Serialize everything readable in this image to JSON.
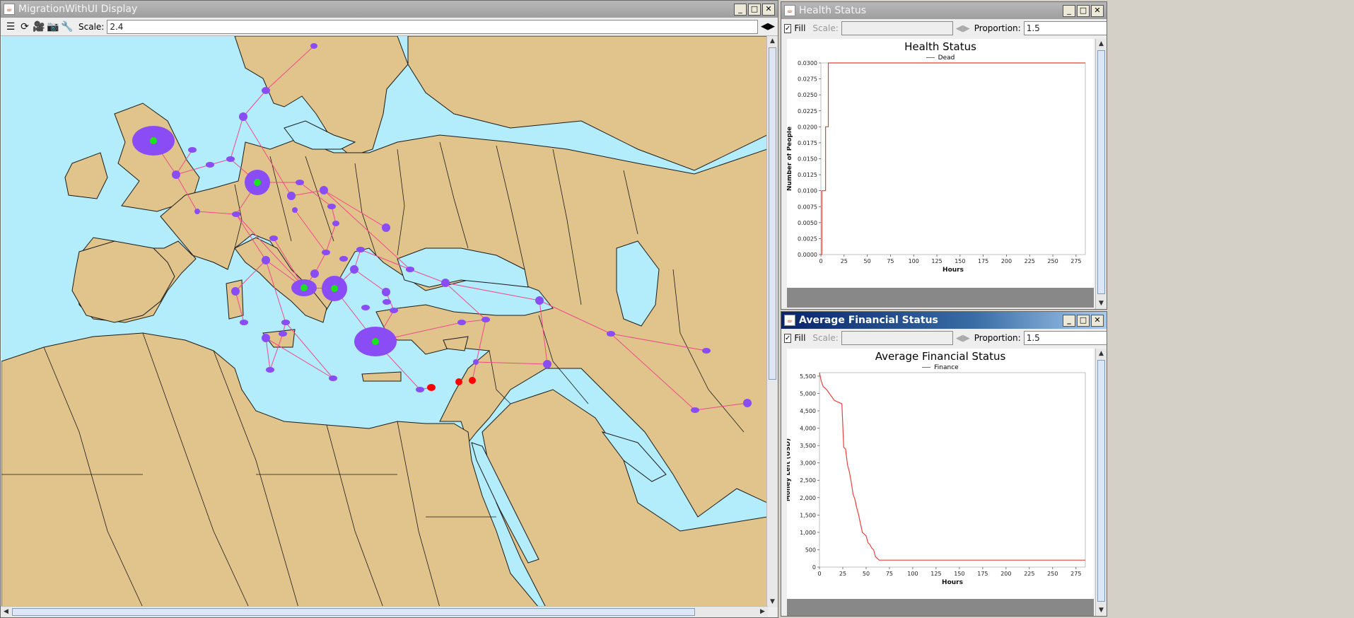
{
  "main_window": {
    "title": "MigrationWithUI Display",
    "scale_label": "Scale:",
    "scale_value": "2.4",
    "toolbar_icons": [
      "layers-icon",
      "refresh-icon",
      "movie-icon",
      "camera-icon",
      "wrench-icon"
    ],
    "map_colors": {
      "sea": "#b3ecfb",
      "land": "#e1c48c",
      "border": "#1a1a1a",
      "node": "#8a4cf5",
      "node_core": "#19e619",
      "edge": "#ee4a8a",
      "danger": "#ff0000"
    }
  },
  "health_window": {
    "title": "Health Status",
    "fill_label": "Fill",
    "scale_label": "Scale:",
    "scale_value": "",
    "proportion_label": "Proportion:",
    "proportion_value": "1.5"
  },
  "finance_window": {
    "title": "Average Financial Status",
    "fill_label": "Fill",
    "scale_label": "Scale:",
    "scale_value": "",
    "proportion_label": "Proportion:",
    "proportion_value": "1.5"
  },
  "chart_data": [
    {
      "type": "line",
      "title": "Health Status",
      "xlabel": "Hours",
      "ylabel": "Number of People",
      "xlim": [
        0,
        285
      ],
      "ylim": [
        0,
        0.03
      ],
      "xticks": [
        "0",
        "25",
        "50",
        "75",
        "100",
        "125",
        "150",
        "175",
        "200",
        "225",
        "250",
        "275"
      ],
      "yticks": [
        "0.0000",
        "0.0025",
        "0.0050",
        "0.0075",
        "0.0100",
        "0.0125",
        "0.0150",
        "0.0175",
        "0.0200",
        "0.0225",
        "0.0250",
        "0.0275",
        "0.0300"
      ],
      "series": [
        {
          "name": "Dead",
          "color": "#e84040",
          "x": [
            0,
            1,
            1,
            5,
            5,
            8,
            8,
            10,
            10,
            285
          ],
          "y": [
            0,
            0,
            0.01,
            0.01,
            0.02,
            0.02,
            0.03,
            0.03,
            0.03,
            0.03
          ]
        }
      ]
    },
    {
      "type": "line",
      "title": "Average Financial Status",
      "xlabel": "Hours",
      "ylabel": "Money Left (USD)",
      "xlim": [
        0,
        285
      ],
      "ylim": [
        0,
        5600
      ],
      "xticks": [
        "0",
        "25",
        "50",
        "75",
        "100",
        "125",
        "150",
        "175",
        "200",
        "225",
        "250",
        "275"
      ],
      "yticks": [
        "0",
        "500",
        "1,000",
        "1,500",
        "2,000",
        "2,500",
        "3,000",
        "3,500",
        "4,000",
        "4,500",
        "5,000",
        "5,500"
      ],
      "series": [
        {
          "name": "Finance",
          "color": "#e84040",
          "x": [
            0,
            2,
            4,
            6,
            8,
            12,
            16,
            20,
            24,
            26,
            28,
            30,
            32,
            34,
            36,
            38,
            40,
            42,
            44,
            46,
            48,
            50,
            52,
            54,
            56,
            58,
            60,
            62,
            64,
            66,
            68,
            70,
            285
          ],
          "y": [
            5600,
            5350,
            5200,
            5150,
            5100,
            4950,
            4800,
            4750,
            4700,
            3450,
            3400,
            2950,
            2750,
            2450,
            2100,
            1950,
            1700,
            1500,
            1250,
            1000,
            950,
            900,
            700,
            650,
            550,
            500,
            300,
            250,
            200,
            200,
            200,
            200,
            200
          ]
        }
      ]
    }
  ]
}
